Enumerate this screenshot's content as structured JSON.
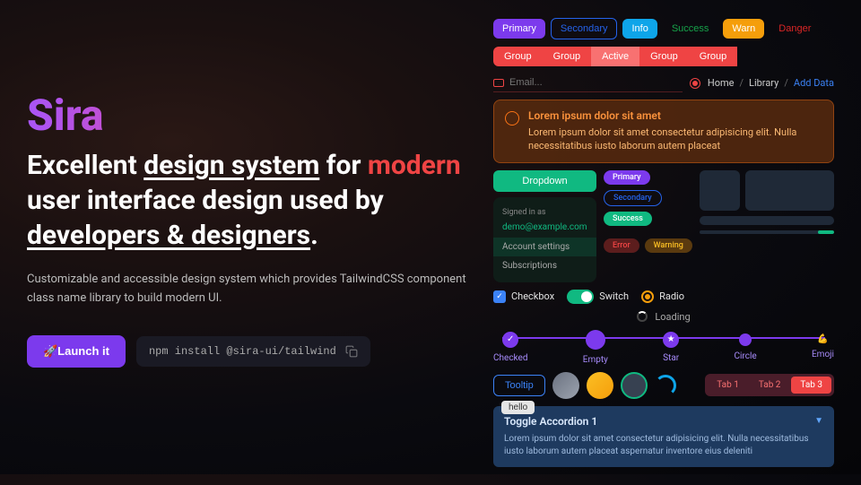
{
  "brand": "Sira",
  "headline": {
    "p1": "Excellent ",
    "ds": "design system",
    "p2": " for ",
    "modern": "modern",
    "p3": " user interface design used by ",
    "dd": "developers & designers",
    "p4": "."
  },
  "sub": "Customizable and accessible design system which provides TailwindCSS component class name library to build modern UI.",
  "cta": {
    "launch": "🚀Launch it",
    "install": "npm install @sira-ui/tailwind"
  },
  "buttons": {
    "primary": "Primary",
    "secondary": "Secondary",
    "info": "Info",
    "success": "Success",
    "warn": "Warn",
    "danger": "Danger"
  },
  "group": {
    "g": "Group",
    "active": "Active"
  },
  "email_placeholder": "Email...",
  "breadcrumb": {
    "home": "Home",
    "library": "Library",
    "add": "Add Data"
  },
  "alert": {
    "title": "Lorem ipsum dolor sit amet",
    "body": "Lorem ipsum dolor sit amet consectetur adipisicing elit. Nulla necessitatibus iusto laborum autem placeat"
  },
  "dropdown": {
    "btn": "Dropdown",
    "signed": "Signed in as",
    "email": "demo@example.com",
    "acct": "Account settings",
    "subs": "Subscriptions"
  },
  "badges": {
    "primary": "Primary",
    "secondary": "Secondary",
    "success": "Success",
    "error": "Error",
    "warning": "Warning"
  },
  "forms": {
    "checkbox": "Checkbox",
    "switch": "Switch",
    "radio": "Radio"
  },
  "loading": "Loading",
  "steps": {
    "checked": "Checked",
    "empty": "Empty",
    "star": "Star",
    "circle": "Circle",
    "emoji": "Emoji",
    "muscle": "💪"
  },
  "tooltip": {
    "btn": "Tooltip",
    "pop": "hello"
  },
  "tabs": {
    "t1": "Tab 1",
    "t2": "Tab 2",
    "t3": "Tab 3"
  },
  "accordion": {
    "title": "Toggle Accordion 1",
    "body": "Lorem ipsum dolor sit amet consectetur adipisicing elit. Nulla necessitatibus iusto laborum autem placeat aspernatur inventore eius deleniti"
  }
}
